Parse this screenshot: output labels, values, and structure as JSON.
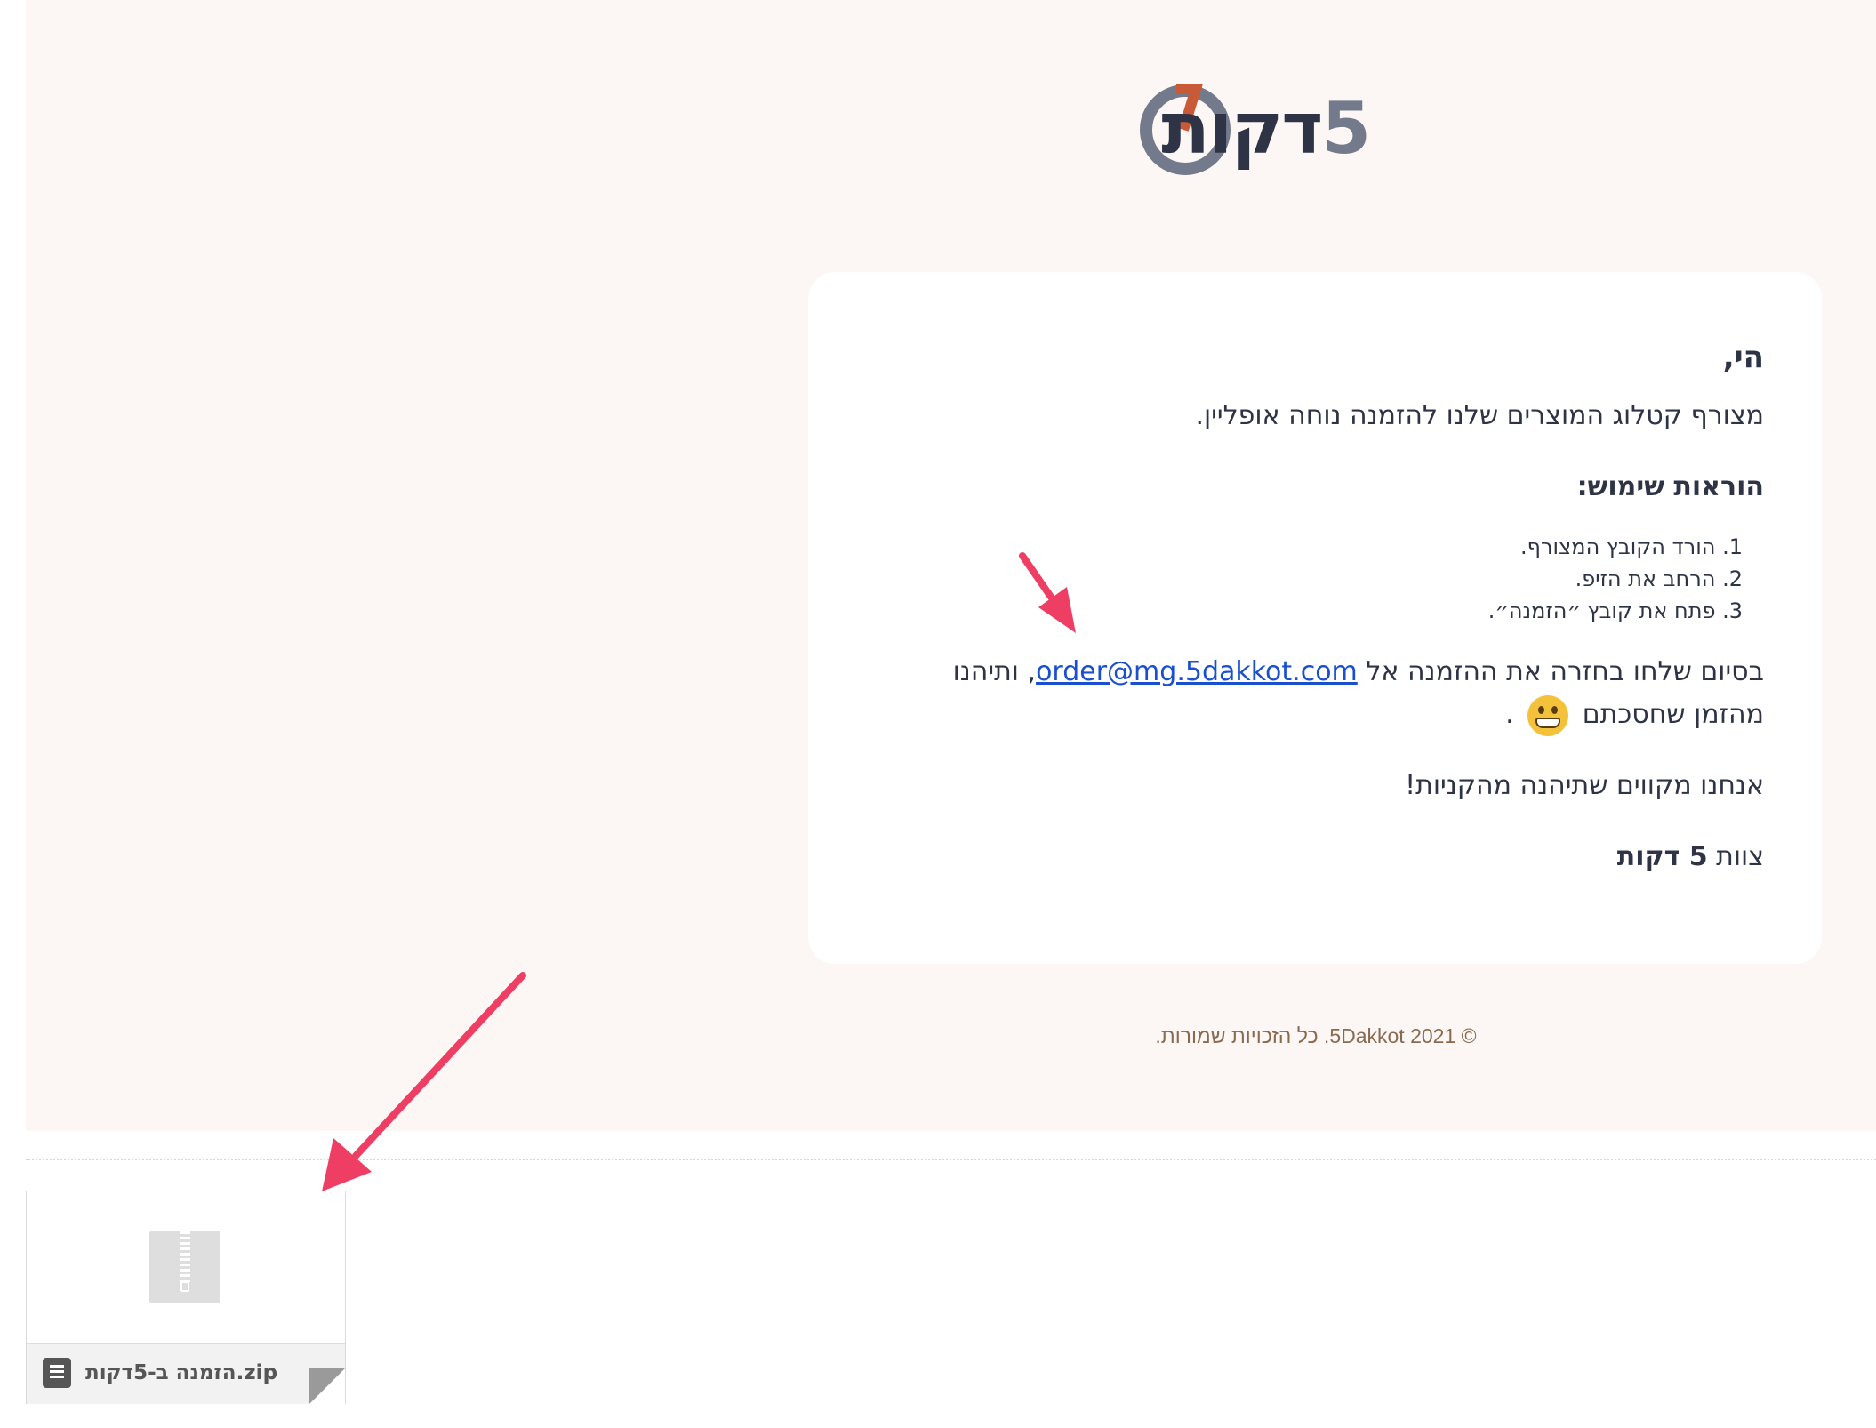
{
  "logo": {
    "word": "דקות",
    "number": "5"
  },
  "card": {
    "greeting": "הי,",
    "intro": "מצורף קטלוג המוצרים שלנו להזמנה נוחה אופליין.",
    "how_title": "הוראות שימוש:",
    "steps": [
      "1. הורד הקובץ המצורף.",
      "2. הרחב את הזיפ.",
      "3. פתח את קובץ ״הזמנה״."
    ],
    "closing_before": "בסיום שלחו בחזרה את ההזמנה אל ",
    "email_link": "order@mg.5dakkot.com",
    "closing_after": ", ותיהנו מהזמן שחסכתם",
    "closing_end": ".",
    "emoji": "grinning-face",
    "hope": "אנחנו מקווים שתיהנה מהקניות!",
    "signoff_team": "צוות",
    "signoff_brand": "5 דקות"
  },
  "footer": "© 2021 5Dakkot. כל הזכויות שמורות.",
  "attachment": {
    "filename": "הזמנה ב-5דקות.zip",
    "icon": "zip-file-icon"
  },
  "colors": {
    "email_background": "#fcf7f4",
    "text": "#2e3446",
    "link": "#1a4fd0",
    "arrow": "#ee3e63",
    "logo_accent": "#c95a38"
  }
}
